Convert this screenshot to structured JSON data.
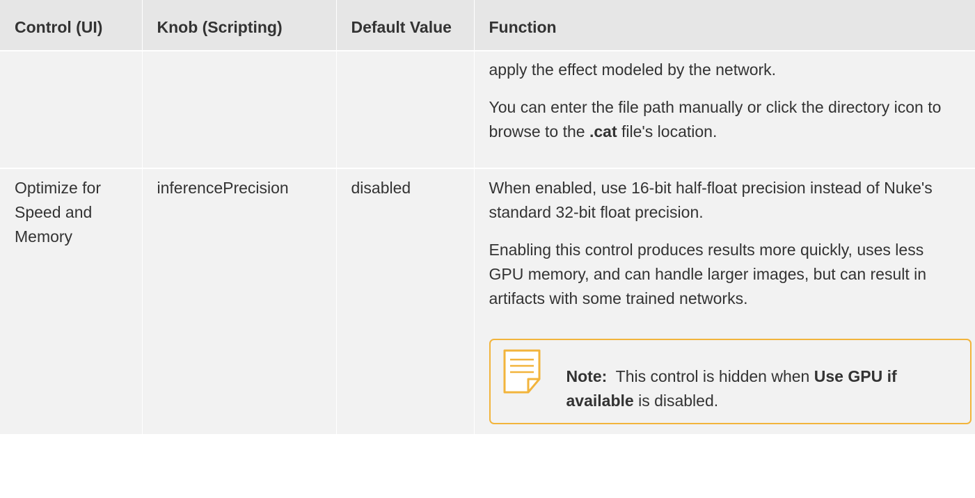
{
  "table": {
    "headers": [
      "Control (UI)",
      "Knob (Scripting)",
      "Default Value",
      "Function"
    ],
    "row1": {
      "control": "",
      "knob": "",
      "default": "",
      "func_p1": "apply the effect modeled by the network.",
      "func_p2_a": "You can enter the file path manually or click the directory icon to browse to the ",
      "func_p2_bold": ".cat",
      "func_p2_b": " file's location."
    },
    "row2": {
      "control": "Optimize for Speed and Memory",
      "knob": "inferencePrecision",
      "default": "disabled",
      "func_p1": "When enabled, use 16-bit half-float precision instead of Nuke's standard 32-bit float precision.",
      "func_p2": "Enabling this control produces results more quickly, uses less GPU memory, and can handle larger images, but can result in artifacts with some trained networks."
    }
  },
  "note": {
    "label": "Note:",
    "text_a": "  This control is hidden when ",
    "bold": "Use GPU if available",
    "text_b": " is disabled.",
    "icon": "note-icon"
  },
  "colors": {
    "header_bg": "#e6e6e6",
    "cell_bg": "#f2f2f2",
    "note_border": "#f2b43c"
  }
}
